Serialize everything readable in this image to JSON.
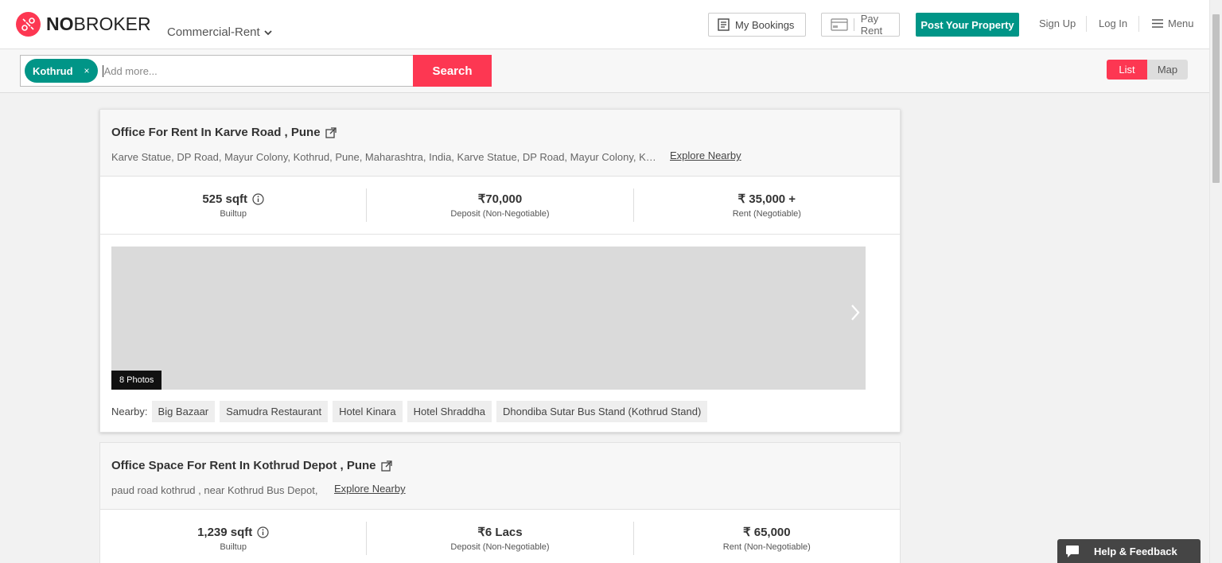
{
  "header": {
    "logo_bold": "NO",
    "logo_rest": "BROKER",
    "category": "Commercial-Rent",
    "my_bookings": "My Bookings",
    "pay_rent": "Pay Rent",
    "post_property": "Post Your Property",
    "sign_up": "Sign Up",
    "log_in": "Log In",
    "menu": "Menu"
  },
  "search": {
    "chip_label": "Kothrud",
    "chip_close": "×",
    "placeholder": "Add more...",
    "button": "Search",
    "view_list": "List",
    "view_map": "Map"
  },
  "listings": [
    {
      "title": "Office For Rent In Karve Road , Pune",
      "address": "Karve Statue, DP Road, Mayur Colony, Kothrud, Pune, Maharashtra, India, Karve Statue, DP Road, Mayur Colony, Kothrud, Pune",
      "explore": "Explore Nearby",
      "area_value": "525 sqft",
      "area_label": "Builtup",
      "deposit_value": "₹70,000",
      "deposit_label": "Deposit (Non-Negotiable)",
      "rent_value": "₹ 35,000 +",
      "rent_label": "Rent (Negotiable)",
      "photos": "8 Photos",
      "nearby_label": "Nearby:",
      "nearby": [
        "Big Bazaar",
        "Samudra Restaurant",
        "Hotel Kinara",
        "Hotel Shraddha",
        "Dhondiba Sutar Bus Stand (Kothrud Stand)"
      ]
    },
    {
      "title": "Office Space For Rent In Kothrud Depot , Pune",
      "address": "paud road kothrud , near Kothrud Bus Depot,",
      "explore": "Explore Nearby",
      "area_value": "1,239 sqft",
      "area_label": "Builtup",
      "deposit_value": "₹6 Lacs",
      "deposit_label": "Deposit (Non-Negotiable)",
      "rent_value": "₹ 65,000",
      "rent_label": "Rent (Non-Negotiable)"
    }
  ],
  "help": "Help & Feedback",
  "colors": {
    "brand_red": "#fd3752",
    "teal": "#009587"
  }
}
